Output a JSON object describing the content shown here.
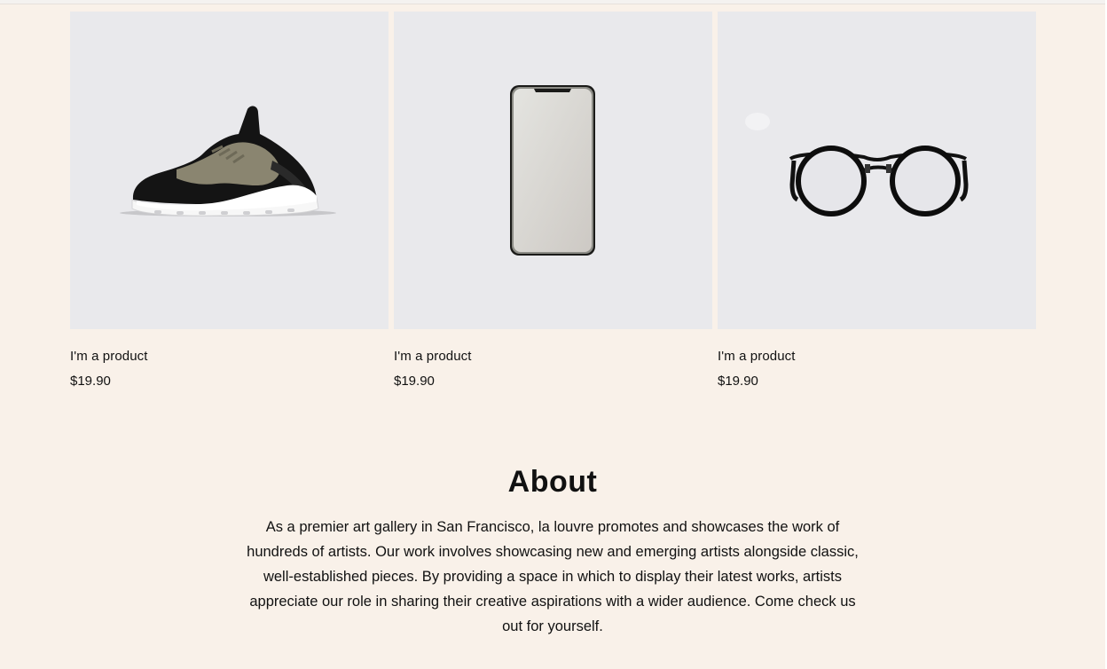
{
  "products": [
    {
      "image_icon": "sneaker-icon",
      "name": "I'm a product",
      "price": "$19.90"
    },
    {
      "image_icon": "smartphone-icon",
      "name": "I'm a product",
      "price": "$19.90"
    },
    {
      "image_icon": "eyeglasses-icon",
      "name": "I'm a product",
      "price": "$19.90"
    }
  ],
  "about": {
    "title": "About",
    "text": "As a premier art gallery in San Francisco, la louvre promotes and showcases the work of hundreds of artists. Our work involves showcasing new and emerging artists alongside classic, well-established pieces. By providing a space in which to display their latest works, artists appreciate our role in sharing their creative aspirations with a wider audience. Come check us out for yourself."
  },
  "colors": {
    "page_background": "#f9f1e9",
    "product_image_background": "#e9e9ec",
    "text": "#111111"
  }
}
